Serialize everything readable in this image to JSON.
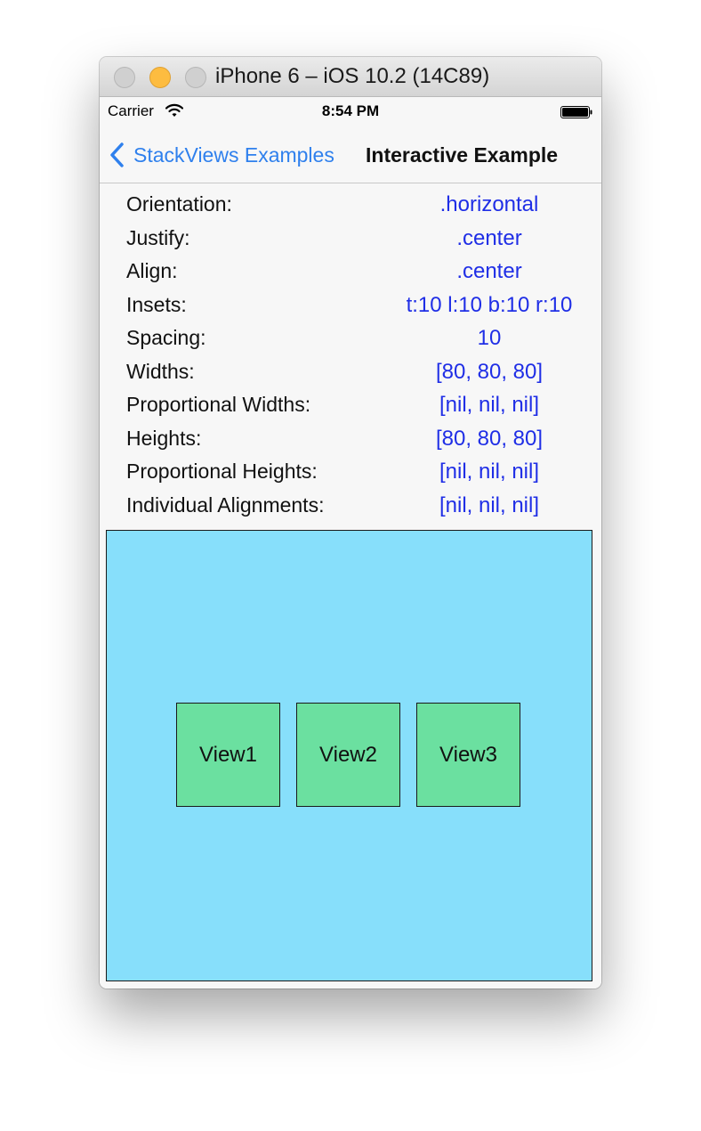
{
  "window": {
    "title": "iPhone 6 – iOS 10.2 (14C89)"
  },
  "status_bar": {
    "carrier": "Carrier",
    "time": "8:54 PM"
  },
  "nav": {
    "back_label": "StackViews Examples",
    "title": "Interactive Example"
  },
  "config": [
    {
      "label": "Orientation:",
      "value": ".horizontal"
    },
    {
      "label": "Justify:",
      "value": ".center"
    },
    {
      "label": "Align:",
      "value": ".center"
    },
    {
      "label": "Insets:",
      "value": "t:10 l:10 b:10 r:10"
    },
    {
      "label": "Spacing:",
      "value": "10"
    },
    {
      "label": "Widths:",
      "value": "[80, 80, 80]"
    },
    {
      "label": "Proportional Widths:",
      "value": "[nil, nil, nil]"
    },
    {
      "label": "Heights:",
      "value": "[80, 80, 80]"
    },
    {
      "label": "Proportional Heights:",
      "value": "[nil, nil, nil]"
    },
    {
      "label": "Individual Alignments:",
      "value": "[nil, nil, nil]"
    }
  ],
  "stack": {
    "views": [
      "View1",
      "View2",
      "View3"
    ]
  },
  "colors": {
    "accent": "#2f80ed",
    "value_text": "#1f2ee6",
    "container_bg": "#87dffb",
    "view_bg": "#6be0a0"
  }
}
